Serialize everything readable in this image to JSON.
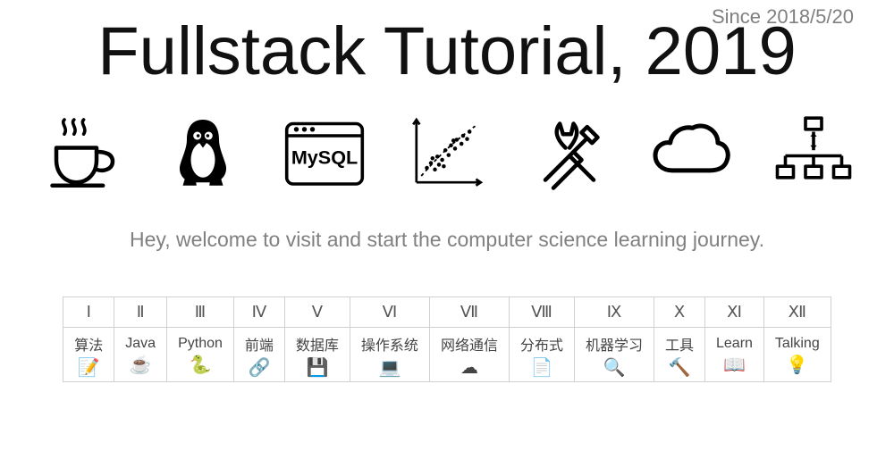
{
  "meta": {
    "since": "Since 2018/5/20"
  },
  "header": {
    "title": "Fullstack Tutorial, 2019"
  },
  "welcome": "Hey, welcome to visit and start the computer science learning journey.",
  "categories": [
    {
      "numeral": "Ⅰ",
      "label": "算法",
      "icon": "📝"
    },
    {
      "numeral": "Ⅱ",
      "label": "Java",
      "icon": "☕"
    },
    {
      "numeral": "Ⅲ",
      "label": "Python",
      "icon": "🐍"
    },
    {
      "numeral": "Ⅳ",
      "label": "前端",
      "icon": "🔗"
    },
    {
      "numeral": "Ⅴ",
      "label": "数据库",
      "icon": "💾"
    },
    {
      "numeral": "Ⅵ",
      "label": "操作系统",
      "icon": "💻"
    },
    {
      "numeral": "Ⅶ",
      "label": "网络通信",
      "icon": "☁"
    },
    {
      "numeral": "Ⅷ",
      "label": "分布式",
      "icon": "📄"
    },
    {
      "numeral": "Ⅸ",
      "label": "机器学习",
      "icon": "🔍"
    },
    {
      "numeral": "Ⅹ",
      "label": "工具",
      "icon": "🔨"
    },
    {
      "numeral": "Ⅺ",
      "label": "Learn",
      "icon": "📖"
    },
    {
      "numeral": "Ⅻ",
      "label": "Talking",
      "icon": "💡"
    }
  ]
}
